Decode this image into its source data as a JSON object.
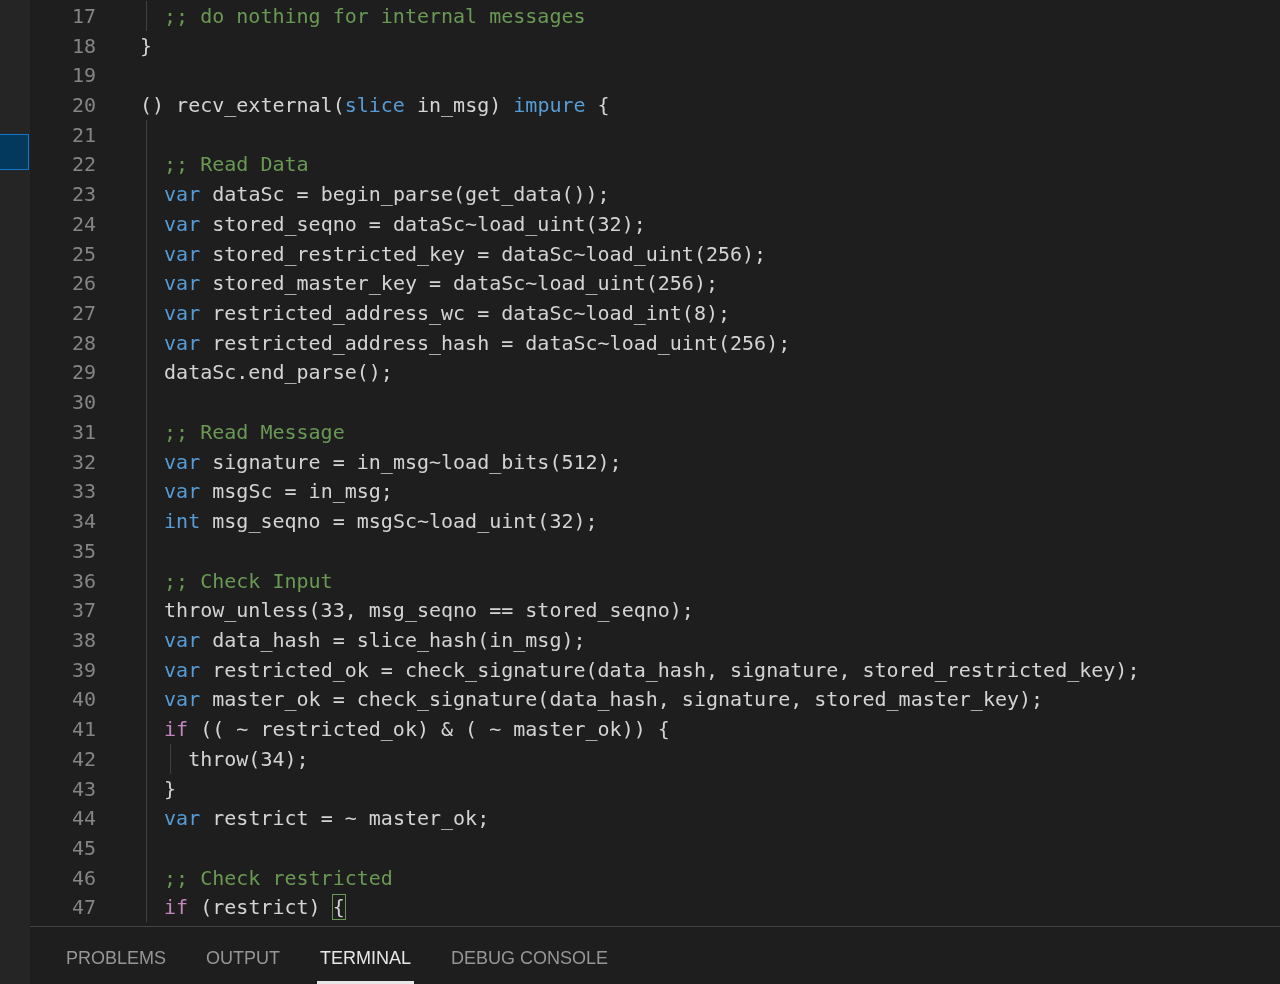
{
  "editor": {
    "lines": [
      {
        "number": "17",
        "tokens": [
          {
            "kind": "comment",
            "text": "  ;; do nothing for internal messages"
          }
        ]
      },
      {
        "number": "18",
        "tokens": [
          {
            "kind": "plain",
            "text": "}"
          }
        ]
      },
      {
        "number": "19"
      },
      {
        "number": "20",
        "tokens": [
          {
            "kind": "plain",
            "text": "() recv_external("
          },
          {
            "kind": "keyword",
            "text": "slice"
          },
          {
            "kind": "plain",
            "text": " in_msg) "
          },
          {
            "kind": "keyword",
            "text": "impure"
          },
          {
            "kind": "plain",
            "text": " {"
          }
        ]
      },
      {
        "number": "21"
      },
      {
        "number": "22",
        "tokens": [
          {
            "kind": "comment",
            "text": "  ;; Read Data"
          }
        ]
      },
      {
        "number": "23",
        "tokens": [
          {
            "kind": "keyword",
            "text": "  var"
          },
          {
            "kind": "plain",
            "text": " dataSc = begin_parse(get_data());"
          }
        ]
      },
      {
        "number": "24",
        "tokens": [
          {
            "kind": "keyword",
            "text": "  var"
          },
          {
            "kind": "plain",
            "text": " stored_seqno = dataSc~load_uint(32);"
          }
        ]
      },
      {
        "number": "25",
        "tokens": [
          {
            "kind": "keyword",
            "text": "  var"
          },
          {
            "kind": "plain",
            "text": " stored_restricted_key = dataSc~load_uint(256);"
          }
        ]
      },
      {
        "number": "26",
        "tokens": [
          {
            "kind": "keyword",
            "text": "  var"
          },
          {
            "kind": "plain",
            "text": " stored_master_key = dataSc~load_uint(256);"
          }
        ]
      },
      {
        "number": "27",
        "tokens": [
          {
            "kind": "keyword",
            "text": "  var"
          },
          {
            "kind": "plain",
            "text": " restricted_address_wc = dataSc~load_int(8);"
          }
        ]
      },
      {
        "number": "28",
        "tokens": [
          {
            "kind": "keyword",
            "text": "  var"
          },
          {
            "kind": "plain",
            "text": " restricted_address_hash = dataSc~load_uint(256);"
          }
        ]
      },
      {
        "number": "29",
        "tokens": [
          {
            "kind": "plain",
            "text": "  dataSc.end_parse();"
          }
        ]
      },
      {
        "number": "30"
      },
      {
        "number": "31",
        "tokens": [
          {
            "kind": "comment",
            "text": "  ;; Read Message"
          }
        ]
      },
      {
        "number": "32",
        "tokens": [
          {
            "kind": "keyword",
            "text": "  var"
          },
          {
            "kind": "plain",
            "text": " signature = in_msg~load_bits(512);"
          }
        ]
      },
      {
        "number": "33",
        "tokens": [
          {
            "kind": "keyword",
            "text": "  var"
          },
          {
            "kind": "plain",
            "text": " msgSc = in_msg;"
          }
        ]
      },
      {
        "number": "34",
        "tokens": [
          {
            "kind": "keyword",
            "text": "  int"
          },
          {
            "kind": "plain",
            "text": " msg_seqno = msgSc~load_uint(32);"
          }
        ]
      },
      {
        "number": "35"
      },
      {
        "number": "36",
        "tokens": [
          {
            "kind": "comment",
            "text": "  ;; Check Input"
          }
        ]
      },
      {
        "number": "37",
        "tokens": [
          {
            "kind": "plain",
            "text": "  throw_unless(33, msg_seqno == stored_seqno);"
          }
        ]
      },
      {
        "number": "38",
        "tokens": [
          {
            "kind": "keyword",
            "text": "  var"
          },
          {
            "kind": "plain",
            "text": " data_hash = slice_hash(in_msg);"
          }
        ]
      },
      {
        "number": "39",
        "tokens": [
          {
            "kind": "keyword",
            "text": "  var"
          },
          {
            "kind": "plain",
            "text": " restricted_ok = check_signature(data_hash, signature, stored_restricted_key);"
          }
        ]
      },
      {
        "number": "40",
        "tokens": [
          {
            "kind": "keyword",
            "text": "  var"
          },
          {
            "kind": "plain",
            "text": " master_ok = check_signature(data_hash, signature, stored_master_key);"
          }
        ]
      },
      {
        "number": "41",
        "tokens": [
          {
            "kind": "control",
            "text": "  if"
          },
          {
            "kind": "plain",
            "text": " (( ~ restricted_ok) & ( ~ master_ok)) {"
          }
        ]
      },
      {
        "number": "42",
        "tokens": [
          {
            "kind": "plain",
            "text": "    throw(34);"
          }
        ]
      },
      {
        "number": "43",
        "tokens": [
          {
            "kind": "plain",
            "text": "  }"
          }
        ]
      },
      {
        "number": "44",
        "tokens": [
          {
            "kind": "keyword",
            "text": "  var"
          },
          {
            "kind": "plain",
            "text": " restrict = ~ master_ok;"
          }
        ]
      },
      {
        "number": "45"
      },
      {
        "number": "46",
        "tokens": [
          {
            "kind": "comment",
            "text": "  ;; Check restricted"
          }
        ]
      },
      {
        "number": "47",
        "tokens": [
          {
            "kind": "control",
            "text": "  if"
          },
          {
            "kind": "plain",
            "text": " (restrict) "
          },
          {
            "kind": "bracket-match",
            "text": "{"
          }
        ]
      }
    ]
  },
  "panel": {
    "tabs": [
      {
        "label": "PROBLEMS",
        "selected": false
      },
      {
        "label": "OUTPUT",
        "selected": false
      },
      {
        "label": "TERMINAL",
        "selected": true
      },
      {
        "label": "DEBUG CONSOLE",
        "selected": false
      }
    ]
  }
}
